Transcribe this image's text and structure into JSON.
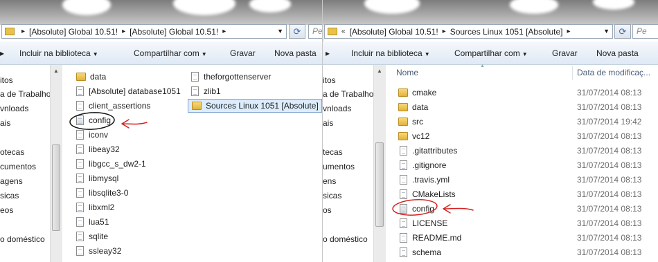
{
  "left": {
    "address": {
      "parts": [
        "[Absolute] Global 10.51!",
        "[Absolute] Global 10.51!"
      ]
    },
    "search": {
      "placeholder": "Pe"
    },
    "toolbar": {
      "include_library": "Incluir na biblioteca",
      "share_with": "Compartilhar com",
      "burn": "Gravar",
      "new_folder": "Nova pasta"
    },
    "nav": [
      "itos",
      "a de Trabalho",
      "vnloads",
      "ais",
      "otecas",
      "cumentos",
      "agens",
      "sicas",
      "eos",
      "o doméstico"
    ],
    "col1": [
      {
        "name": "data",
        "icon": "folder"
      },
      {
        "name": "[Absolute] database1051",
        "icon": "file"
      },
      {
        "name": "client_assertions",
        "icon": "file"
      },
      {
        "name": "config",
        "icon": "config-file"
      },
      {
        "name": "iconv",
        "icon": "file"
      },
      {
        "name": "libeay32",
        "icon": "file"
      },
      {
        "name": "libgcc_s_dw2-1",
        "icon": "file"
      },
      {
        "name": "libmysql",
        "icon": "file"
      },
      {
        "name": "libsqlite3-0",
        "icon": "file"
      },
      {
        "name": "libxml2",
        "icon": "file"
      },
      {
        "name": "lua51",
        "icon": "file"
      },
      {
        "name": "sqlite",
        "icon": "file"
      },
      {
        "name": "ssleay32",
        "icon": "file"
      }
    ],
    "col2": [
      {
        "name": "theforgottenserver",
        "icon": "file"
      },
      {
        "name": "zlib1",
        "icon": "file"
      },
      {
        "name": "Sources Linux 1051 [Absolute]",
        "icon": "folder",
        "selected": true
      }
    ]
  },
  "right": {
    "address": {
      "prefix": "«",
      "parts": [
        "[Absolute] Global 10.51!",
        "Sources Linux 1051 [Absolute]"
      ]
    },
    "search": {
      "placeholder": "Pe"
    },
    "toolbar": {
      "include_library": "Incluir na biblioteca",
      "share_with": "Compartilhar com",
      "burn": "Gravar",
      "new_folder": "Nova pasta"
    },
    "nav": [
      "itos",
      "a de Trabalho",
      "vnloads",
      "ais",
      "tecas",
      "umentos",
      "ens",
      "sicas",
      "os",
      "o doméstico"
    ],
    "columns": {
      "name": "Nome",
      "date": "Data de modificaç..."
    },
    "files": [
      {
        "name": "cmake",
        "icon": "folder",
        "date": "31/07/2014 08:13"
      },
      {
        "name": "data",
        "icon": "folder",
        "date": "31/07/2014 08:13"
      },
      {
        "name": "src",
        "icon": "folder",
        "date": "31/07/2014 19:42"
      },
      {
        "name": "vc12",
        "icon": "folder",
        "date": "31/07/2014 08:13"
      },
      {
        "name": ".gitattributes",
        "icon": "file",
        "date": "31/07/2014 08:13"
      },
      {
        "name": ".gitignore",
        "icon": "file",
        "date": "31/07/2014 08:13"
      },
      {
        "name": ".travis.yml",
        "icon": "file",
        "date": "31/07/2014 08:13"
      },
      {
        "name": "CMakeLists",
        "icon": "file",
        "date": "31/07/2014 08:13"
      },
      {
        "name": "config",
        "icon": "config-file",
        "date": "31/07/2014 08:13"
      },
      {
        "name": "LICENSE",
        "icon": "file",
        "date": "31/07/2014 08:13"
      },
      {
        "name": "README.md",
        "icon": "file",
        "date": "31/07/2014 08:13"
      },
      {
        "name": "schema",
        "icon": "file",
        "date": "31/07/2014 08:13"
      }
    ]
  },
  "colors": {
    "annotation_red": "#d42020",
    "annotation_black": "#111111",
    "selection": "#dcecfc"
  }
}
